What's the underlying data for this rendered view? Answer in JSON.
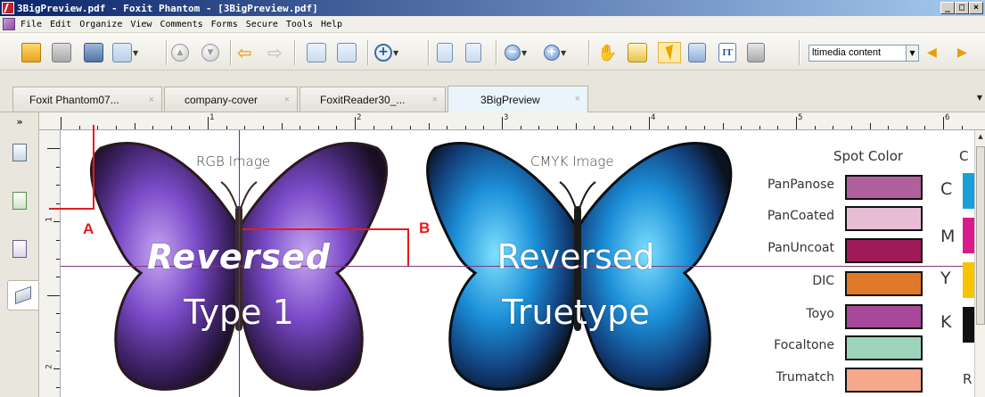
{
  "window": {
    "title": "3BigPreview.pdf - Foxit Phantom - [3BigPreview.pdf]",
    "controls": [
      "_",
      "□",
      "×"
    ]
  },
  "menu": [
    "File",
    "Edit",
    "Organize",
    "View",
    "Comments",
    "Forms",
    "Secure",
    "Tools",
    "Help"
  ],
  "toolbar": {
    "icons": [
      "open-folder-icon",
      "save-icon",
      "print-icon",
      "email-icon",
      "previous-page-icon",
      "next-page-icon",
      "back-icon",
      "forward-icon",
      "single-page-icon",
      "continuous-page-icon",
      "zoom-in-icon",
      "fit-page-icon",
      "fit-width-icon",
      "zoom-out-icon",
      "zoom-plus-icon",
      "hand-tool-icon",
      "select-text-icon",
      "select-annotation-icon",
      "find-icon",
      "typewriter-icon",
      "snapshot-icon"
    ],
    "combo_value": "ltimedia content",
    "media_buttons": [
      "◀",
      "▶"
    ]
  },
  "tabs": [
    {
      "label": "Foxit Phantom07...",
      "active": false
    },
    {
      "label": "company-cover",
      "active": false
    },
    {
      "label": "FoxitReader30_...",
      "active": false
    },
    {
      "label": "3BigPreview",
      "active": true
    }
  ],
  "side_panel": {
    "expand_label": "»",
    "buttons": [
      "pages-icon",
      "bookmarks-icon",
      "annotations-icon",
      "layers-icon"
    ]
  },
  "rulers": {
    "top_numbers": [
      "1",
      "2",
      "3",
      "4",
      "5",
      "6"
    ],
    "left_numbers": [
      "1",
      "2"
    ]
  },
  "document": {
    "rgb_label": "RGB Image",
    "cmyk_label": "CMYK Image",
    "rgb_text": [
      "Reversed",
      "Type 1"
    ],
    "cmyk_text": [
      "Reversed",
      "Truetype"
    ],
    "spot_title": "Spot Color",
    "cmyk_title_partial": "C",
    "spot_colors": [
      {
        "name": "PanPanose",
        "color": "#b0609c"
      },
      {
        "name": "PanCoated",
        "color": "#e8bcd6"
      },
      {
        "name": "PanUncoat",
        "color": "#a01a5a"
      },
      {
        "name": "DIC",
        "color": "#e07a2a"
      },
      {
        "name": "Toyo",
        "color": "#a8489a"
      },
      {
        "name": "Focaltone",
        "color": "#9fd4bc"
      },
      {
        "name": "Trumatch",
        "color": "#f6a88c"
      }
    ],
    "cmyk_channels": [
      {
        "letter": "C",
        "color": "#1aa0d8"
      },
      {
        "letter": "M",
        "color": "#d81a8a"
      },
      {
        "letter": "Y",
        "color": "#f6c400"
      },
      {
        "letter": "K",
        "color": "#111111"
      }
    ],
    "partial_right_letter": "R"
  },
  "callouts": [
    {
      "label": "A"
    },
    {
      "label": "B"
    }
  ],
  "colors": {
    "guide_horizontal": "#7a3b7a",
    "guide_vertical": "#3b3bb8",
    "callout": "#e81a1a"
  }
}
